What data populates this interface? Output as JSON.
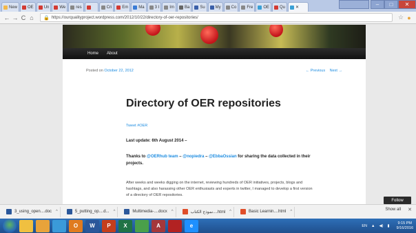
{
  "browser": {
    "tabs": [
      {
        "label": "New",
        "color": "#f2b84b"
      },
      {
        "label": "OE",
        "color": "#d23a33"
      },
      {
        "label": "Un",
        "color": "#d23a33"
      },
      {
        "label": "We",
        "color": "#d23a33"
      },
      {
        "label": "res",
        "color": "#888888"
      },
      {
        "label": "",
        "color": "#d23a33"
      },
      {
        "label": "Cri",
        "color": "#888888"
      },
      {
        "label": "Em",
        "color": "#d23a33"
      },
      {
        "label": "Ma",
        "color": "#3a7bd5"
      },
      {
        "label": "3 I",
        "color": "#888888"
      },
      {
        "label": "Im",
        "color": "#888888"
      },
      {
        "label": "Ba",
        "color": "#666666"
      },
      {
        "label": "Su",
        "color": "#3a5fa8"
      },
      {
        "label": "My",
        "color": "#3a5fa8"
      },
      {
        "label": "Co",
        "color": "#888888"
      },
      {
        "label": "Fre",
        "color": "#888888"
      },
      {
        "label": "OE",
        "color": "#3aa0d5"
      },
      {
        "label": "Qu",
        "color": "#d23a33"
      }
    ],
    "active_tab": {
      "label": "",
      "color": "#3aa0d5"
    },
    "url": "https://ourqualityproject.wordpress.com/2012/10/22/directory-of-oer-repositories/"
  },
  "site": {
    "menu": [
      "Home",
      "About"
    ],
    "posted_prefix": "Posted on",
    "posted_date": "October 22, 2012",
    "prev": "← Previous",
    "next": "Next →",
    "title": "Directory of OER repositories",
    "tweet": "Tweet #OER",
    "last_update": "Last update: 6th August 2014 –",
    "thanks_1": "Thanks to",
    "thanks_h1": "@OERhub team",
    "thanks_dash1": " – ",
    "thanks_h2": "@nopiedra",
    "thanks_dash2": " – ",
    "thanks_h3": "@EbbaOssian",
    "thanks_2": " for sharing the data collected in their projects.",
    "paragraph": "After weeks and weeks digging on the internet, reviewing hundreds of OER initiatives, projects, blogs and hashtags, and also harassing other OER enthusiasts and experts in twitter, I managed to develop a first version of a directory of OER repositories.",
    "follow": "Follow"
  },
  "downloads": [
    {
      "name": "3_using_open....doc",
      "color": "#2b579a"
    },
    {
      "name": "5_putting_op....d...",
      "color": "#2b579a"
    },
    {
      "name": "Multimedia-....docx",
      "color": "#2b579a"
    },
    {
      "name": "نموذج الكتاب....html",
      "color": "#e04e2a"
    },
    {
      "name": "Basic Learnin....html",
      "color": "#e04e2a"
    }
  ],
  "show_all": "Show all",
  "taskbar": {
    "apps": [
      {
        "glyph": "",
        "color": "#f0c040"
      },
      {
        "glyph": "",
        "color": "#e8a33a"
      },
      {
        "glyph": "",
        "color": "#3a9ad9"
      },
      {
        "glyph": "O",
        "color": "#e07b1f"
      },
      {
        "glyph": "W",
        "color": "#2b579a"
      },
      {
        "glyph": "P",
        "color": "#c43e1c"
      },
      {
        "glyph": "X",
        "color": "#217346"
      },
      {
        "glyph": "",
        "color": "#4aa04a"
      },
      {
        "glyph": "A",
        "color": "#a4373a"
      },
      {
        "glyph": "",
        "color": "#b22222"
      },
      {
        "glyph": "e",
        "color": "#1e90ff"
      }
    ],
    "lang": "EN",
    "time": "9:15 PM",
    "date": "9/16/2016"
  }
}
